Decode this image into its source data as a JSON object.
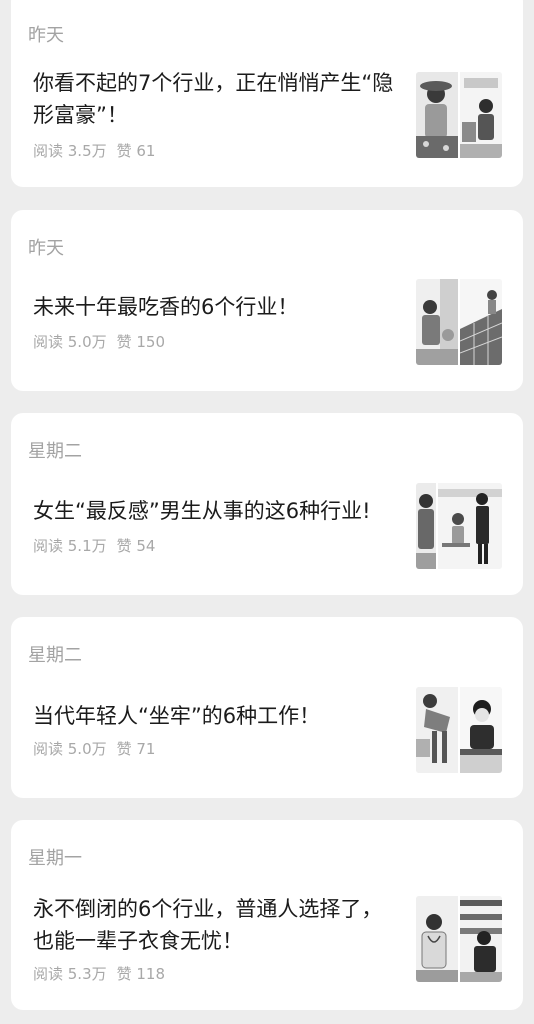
{
  "articles": [
    {
      "day": "昨天",
      "title": "你看不起的7个行业，正在悄悄产生“隐形富豪”！",
      "reads": "阅读 3.5万",
      "likes": "赞 61",
      "thumb_icon": "illustration-two-panels"
    },
    {
      "day": "昨天",
      "title": "未来十年最吃香的6个行业！",
      "reads": "阅读 5.0万",
      "likes": "赞 150",
      "thumb_icon": "illustration-two-panels"
    },
    {
      "day": "星期二",
      "title": "女生“最反感”男生从事的这6种行业!",
      "reads": "阅读 5.1万",
      "likes": "赞 54",
      "thumb_icon": "illustration-two-panels"
    },
    {
      "day": "星期二",
      "title": "当代年轻人“坐牢”的6种工作！",
      "reads": "阅读 5.0万",
      "likes": "赞 71",
      "thumb_icon": "illustration-two-panels"
    },
    {
      "day": "星期一",
      "title": "永不倒闭的6个行业，普通人选择了，也能一辈子衣食无忧！",
      "reads": "阅读 5.3万",
      "likes": "赞 118",
      "thumb_icon": "illustration-two-panels"
    }
  ],
  "colors": {
    "background": "#ededed",
    "card": "#ffffff",
    "title_text": "#1b1b1b",
    "muted_text": "#a3a3a3"
  }
}
